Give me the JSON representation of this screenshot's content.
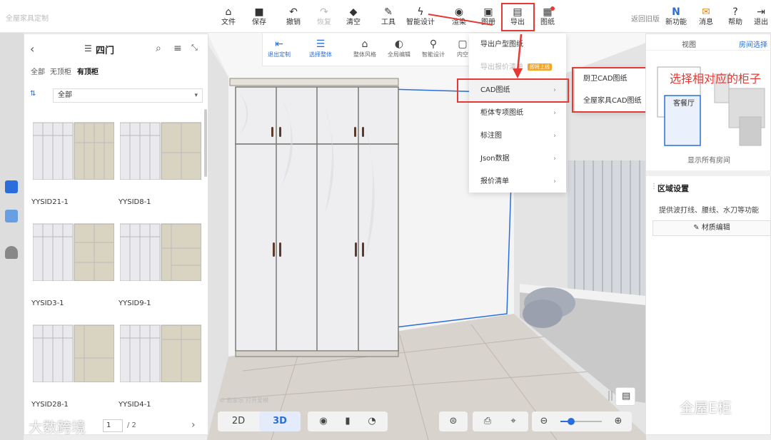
{
  "colors": {
    "accent": "#2a6edb",
    "highlight_red": "#e53935",
    "badge_orange": "#f5a623",
    "wardrobe": "#f0f0f2",
    "frame": "#c8c2b6"
  },
  "brand": "全屋家具定制",
  "toolbar": {
    "items": [
      {
        "label": "文件",
        "icon": "home-file-icon"
      },
      {
        "label": "保存",
        "icon": "save-icon"
      },
      {
        "label": "撤销",
        "icon": "undo-icon"
      },
      {
        "label": "恢复",
        "icon": "redo-icon"
      },
      {
        "label": "清空",
        "icon": "eraser-icon"
      },
      {
        "label": "工具",
        "icon": "wrench-icon"
      },
      {
        "label": "智能设计",
        "icon": "lightning-icon"
      },
      {
        "label": "渲染",
        "icon": "camera-icon"
      },
      {
        "label": "图册",
        "icon": "album-icon"
      },
      {
        "label": "导出",
        "icon": "export-icon"
      },
      {
        "label": "图纸",
        "icon": "drawing-icon"
      }
    ],
    "back_old": "返回旧版",
    "right_items": [
      {
        "label": "新功能",
        "icon": "new-badge-icon",
        "badge": "N"
      },
      {
        "label": "消息",
        "icon": "gift-icon"
      },
      {
        "label": "帮助",
        "icon": "help-icon"
      },
      {
        "label": "退出",
        "icon": "logout-icon"
      }
    ]
  },
  "subbar": {
    "items": [
      {
        "label": "退出定制",
        "icon": "exit-custom-icon"
      },
      {
        "label": "选择整体",
        "icon": "select-whole-icon"
      },
      {
        "label": "整体风格",
        "icon": "style-icon"
      },
      {
        "label": "全局编辑",
        "icon": "global-edit-icon"
      },
      {
        "label": "智能设计",
        "icon": "smart-design-icon"
      },
      {
        "label": "内空",
        "icon": "inner-space-icon"
      }
    ]
  },
  "left_panel": {
    "title": "四门",
    "filters": [
      "全部",
      "无顶柜",
      "有顶柜"
    ],
    "active_filter": "有顶柜",
    "select_value": "全部",
    "items": [
      {
        "name": "YYSID21-1"
      },
      {
        "name": "YYSID8-1"
      },
      {
        "name": "YYSID3-1"
      },
      {
        "name": "YYSID9-1"
      },
      {
        "name": "YYSID28-1"
      },
      {
        "name": "YYSID4-1"
      }
    ],
    "page": "1",
    "page_total": "/ 2"
  },
  "export_menu": {
    "items": [
      {
        "label": "导出户型图纸",
        "has_sub": false,
        "disabled": false
      },
      {
        "label": "导出报价清单",
        "has_sub": false,
        "disabled": true,
        "badge": "即将上线"
      },
      {
        "label": "CAD图纸",
        "has_sub": true,
        "disabled": false,
        "highlight": true
      },
      {
        "label": "柜体专项图纸",
        "has_sub": true,
        "disabled": false
      },
      {
        "label": "标注图",
        "has_sub": true,
        "disabled": false
      },
      {
        "label": "Json数据",
        "has_sub": true,
        "disabled": false
      },
      {
        "label": "报价清单",
        "has_sub": true,
        "disabled": false
      }
    ]
  },
  "cad_submenu": {
    "items": [
      "厨卫CAD图纸",
      "全屋家具CAD图纸"
    ]
  },
  "callout": "选择相对应的柜子",
  "right_panel": {
    "tabs": [
      "视图",
      "房间选择"
    ],
    "active_tab": "房间选择",
    "room_label": "客餐厅",
    "show_all": "显示所有房间",
    "region_title": "区域设置",
    "region_desc": "提供波打线、腰线、水刀等功能",
    "material_button": "材质编辑"
  },
  "bottom": {
    "view_2d": "2D",
    "view_3d": "3D",
    "active_view": "3D",
    "zoom_level": 0.25
  },
  "scene_hint": "© 若家乐 打开爱模",
  "watermarks": [
    "大数跨境",
    "全屋E柜"
  ]
}
